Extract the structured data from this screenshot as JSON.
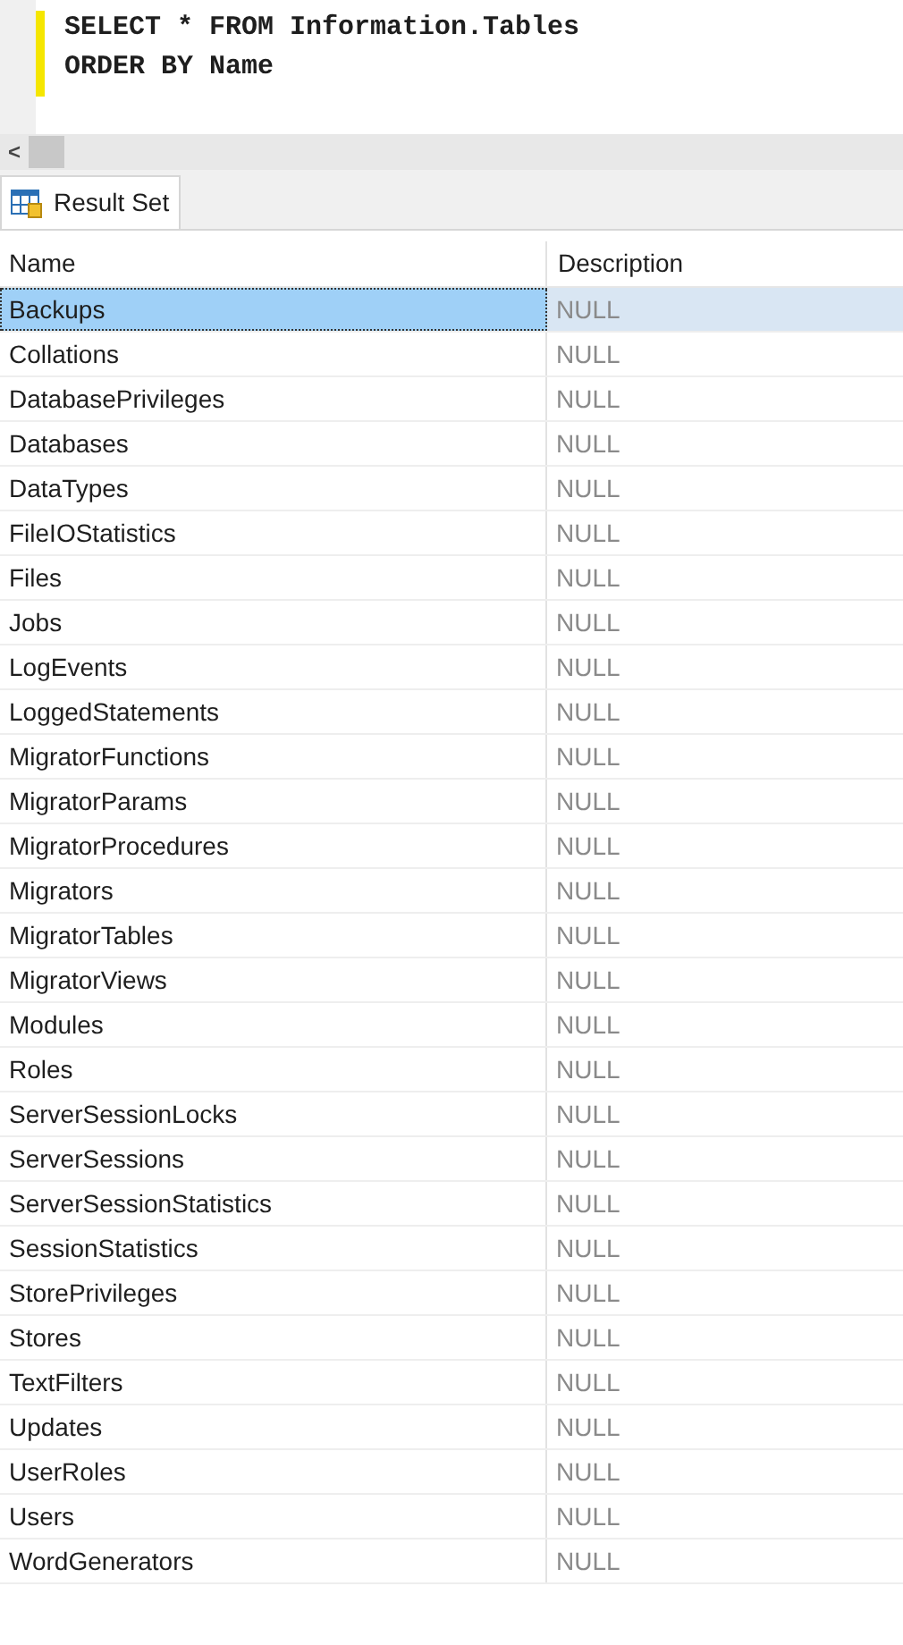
{
  "editor": {
    "lines": [
      "SELECT * FROM Information.Tables",
      "ORDER BY Name"
    ]
  },
  "scrollbar": {
    "arrow": "<"
  },
  "tabs": [
    {
      "label": "Result Set",
      "selected": true
    }
  ],
  "table": {
    "columns": [
      "Name",
      "Description"
    ],
    "rows": [
      {
        "name": "Backups",
        "description": "NULL",
        "selected": true
      },
      {
        "name": "Collations",
        "description": "NULL",
        "selected": false
      },
      {
        "name": "DatabasePrivileges",
        "description": "NULL",
        "selected": false
      },
      {
        "name": "Databases",
        "description": "NULL",
        "selected": false
      },
      {
        "name": "DataTypes",
        "description": "NULL",
        "selected": false
      },
      {
        "name": "FileIOStatistics",
        "description": "NULL",
        "selected": false
      },
      {
        "name": "Files",
        "description": "NULL",
        "selected": false
      },
      {
        "name": "Jobs",
        "description": "NULL",
        "selected": false
      },
      {
        "name": "LogEvents",
        "description": "NULL",
        "selected": false
      },
      {
        "name": "LoggedStatements",
        "description": "NULL",
        "selected": false
      },
      {
        "name": "MigratorFunctions",
        "description": "NULL",
        "selected": false
      },
      {
        "name": "MigratorParams",
        "description": "NULL",
        "selected": false
      },
      {
        "name": "MigratorProcedures",
        "description": "NULL",
        "selected": false
      },
      {
        "name": "Migrators",
        "description": "NULL",
        "selected": false
      },
      {
        "name": "MigratorTables",
        "description": "NULL",
        "selected": false
      },
      {
        "name": "MigratorViews",
        "description": "NULL",
        "selected": false
      },
      {
        "name": "Modules",
        "description": "NULL",
        "selected": false
      },
      {
        "name": "Roles",
        "description": "NULL",
        "selected": false
      },
      {
        "name": "ServerSessionLocks",
        "description": "NULL",
        "selected": false
      },
      {
        "name": "ServerSessions",
        "description": "NULL",
        "selected": false
      },
      {
        "name": "ServerSessionStatistics",
        "description": "NULL",
        "selected": false
      },
      {
        "name": "SessionStatistics",
        "description": "NULL",
        "selected": false
      },
      {
        "name": "StorePrivileges",
        "description": "NULL",
        "selected": false
      },
      {
        "name": "Stores",
        "description": "NULL",
        "selected": false
      },
      {
        "name": "TextFilters",
        "description": "NULL",
        "selected": false
      },
      {
        "name": "Updates",
        "description": "NULL",
        "selected": false
      },
      {
        "name": "UserRoles",
        "description": "NULL",
        "selected": false
      },
      {
        "name": "Users",
        "description": "NULL",
        "selected": false
      },
      {
        "name": "WordGenerators",
        "description": "NULL",
        "selected": false
      }
    ]
  }
}
